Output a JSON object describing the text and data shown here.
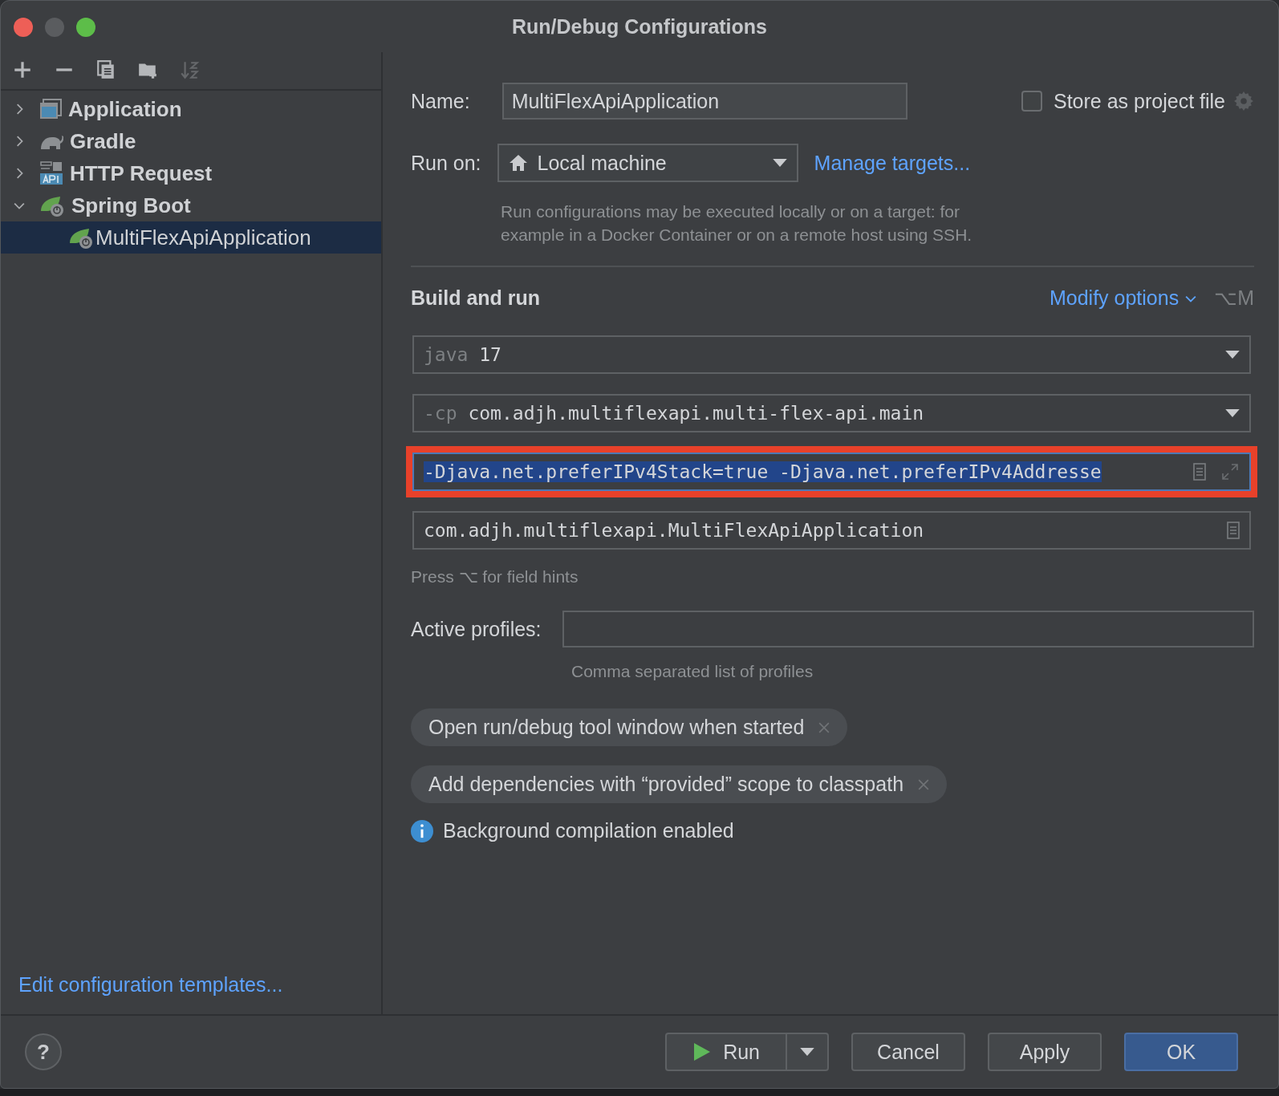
{
  "window": {
    "title": "Run/Debug Configurations"
  },
  "toolbar": [
    {
      "kind": "add",
      "disabled": false
    },
    {
      "kind": "remove",
      "disabled": false
    },
    {
      "kind": "copy",
      "disabled": false
    },
    {
      "kind": "folder",
      "disabled": false
    },
    {
      "kind": "sort",
      "disabled": true
    }
  ],
  "tree": [
    {
      "label": "Application",
      "kind": "app",
      "expanded": false,
      "selected": false
    },
    {
      "label": "Gradle",
      "kind": "gradle",
      "expanded": false,
      "selected": false
    },
    {
      "label": "HTTP Request",
      "kind": "api",
      "expanded": false,
      "selected": false
    },
    {
      "label": "Spring Boot",
      "kind": "spring",
      "expanded": true,
      "selected": false,
      "children": [
        {
          "label": "MultiFlexApiApplication",
          "kind": "spring",
          "selected": true
        }
      ]
    }
  ],
  "sidebar_link": "Edit configuration templates...",
  "form": {
    "name_label": "Name:",
    "name_value": "MultiFlexApiApplication",
    "store": {
      "label": "Store as project file",
      "checked": false
    },
    "run_on_label": "Run on:",
    "run_on_value": "Local machine",
    "manage_link": "Manage targets...",
    "run_on_hint": "Run configurations may be executed locally or on a target: for example in a Docker Container or on a remote host using SSH.",
    "section_title": "Build and run",
    "modify_link": "Modify options",
    "modify_shortcut": "⌥M",
    "fields": [
      {
        "kind": "dropdown",
        "prefix": "java",
        "value": "17",
        "selected": false,
        "highlighted": false
      },
      {
        "kind": "dropdown",
        "prefix": "-cp",
        "value": "com.adjh.multiflexapi.multi-flex-api.main",
        "selected": false,
        "highlighted": false
      },
      {
        "kind": "expandable",
        "value": "-Djava.net.preferIPv4Stack=true -Djava.net.preferIPv4Addresse",
        "selected": true,
        "highlighted": true
      },
      {
        "kind": "browse",
        "value": "com.adjh.multiflexapi.MultiFlexApiApplication",
        "selected": false,
        "highlighted": false
      }
    ],
    "fields_hint": "Press ⌥ for field hints",
    "profiles_label": "Active profiles:",
    "profiles_hint": "Comma separated list of profiles",
    "chips": [
      "Open run/debug tool window when started",
      "Add dependencies with “provided” scope to classpath"
    ],
    "info": "Background compilation enabled"
  },
  "buttons": {
    "help": "?",
    "run": "Run",
    "cancel": "Cancel",
    "apply": "Apply",
    "ok": "OK"
  }
}
